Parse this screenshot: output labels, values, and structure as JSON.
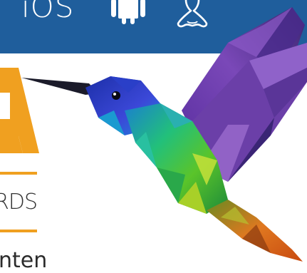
{
  "header": {
    "platform_label": "iOS",
    "icons": [
      "android-icon",
      "linux-icon"
    ],
    "background_color": "#1f5e9c"
  },
  "badge": {
    "awards_text": "RDS",
    "accent_color": "#f0a020"
  },
  "bottom": {
    "partial_text": "nten"
  },
  "illustration": {
    "name": "hummingbird-illustration"
  }
}
